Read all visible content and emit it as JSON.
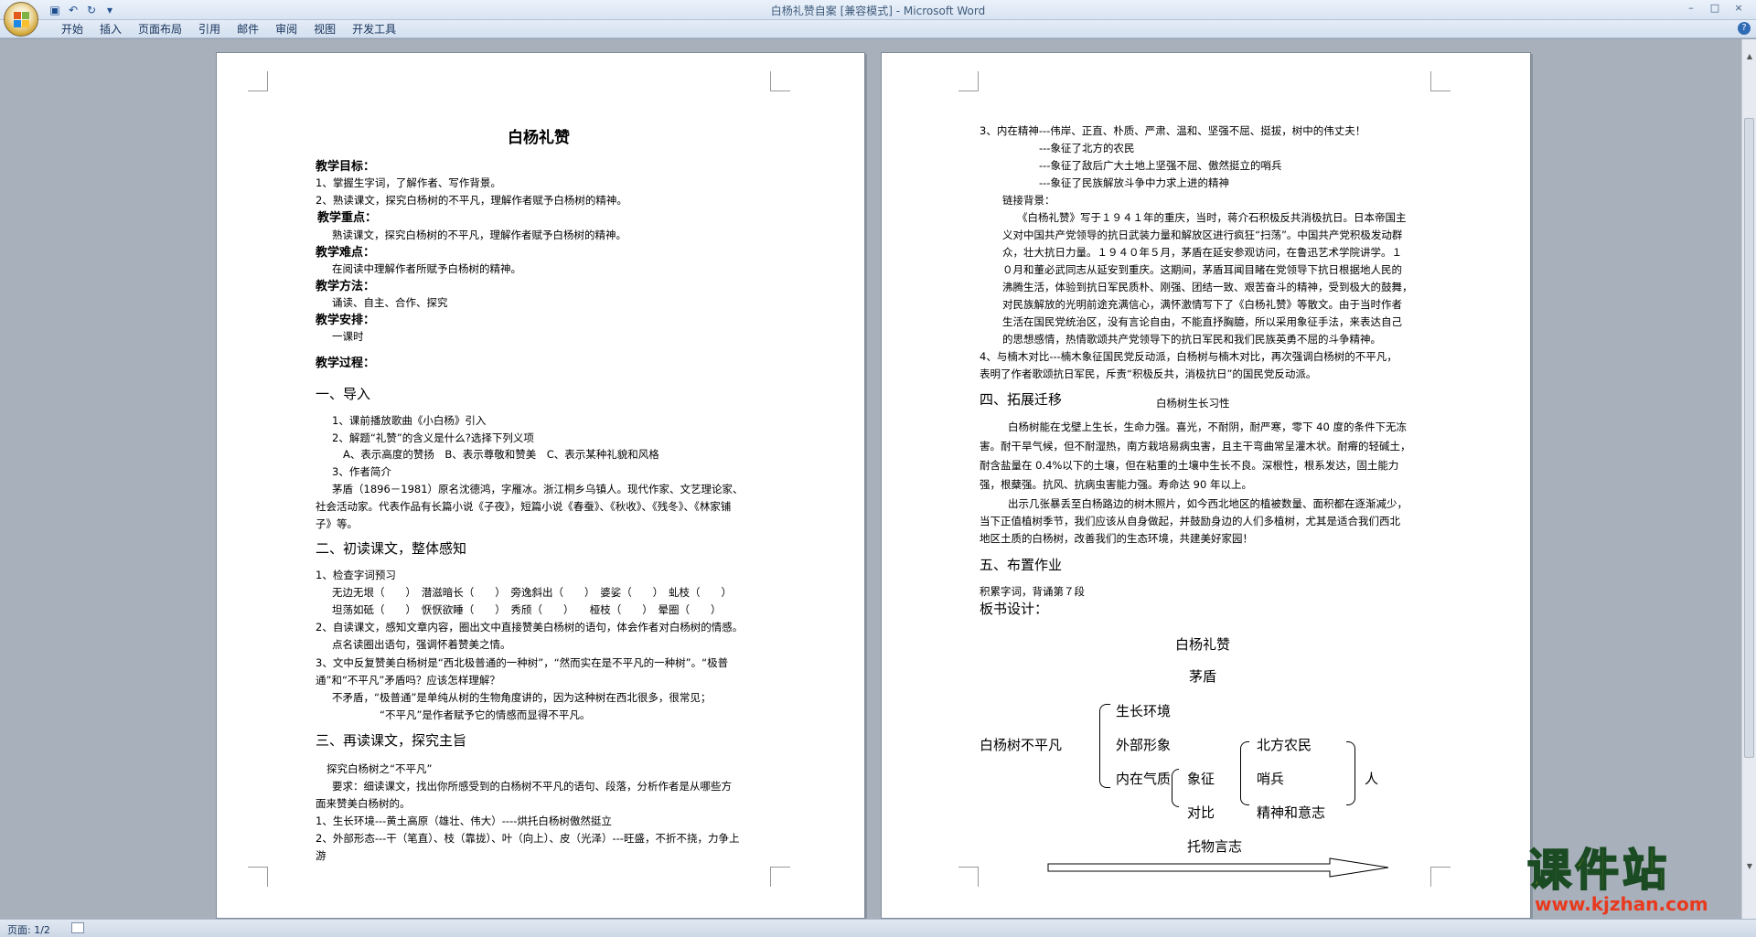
{
  "window": {
    "title": "白杨礼赞自案 [兼容模式] - Microsoft Word",
    "controls": [
      "–",
      "□",
      "×"
    ]
  },
  "ribbon": {
    "tabs": [
      "开始",
      "插入",
      "页面布局",
      "引用",
      "邮件",
      "审阅",
      "视图",
      "开发工具"
    ],
    "help": "?"
  },
  "status": {
    "page": "页面: 1/2"
  },
  "page1": {
    "title": "白杨礼赞",
    "goal_h": "教学目标：",
    "goal_1": "1、掌握生字词，了解作者、写作背景。",
    "goal_2": "2、熟读课文，探究白杨树的不平凡，理解作者赋予白杨树的精神。",
    "key_h": "教学重点：",
    "key_1": "熟读课文，探究白杨树的不平凡，理解作者赋予白杨树的精神。",
    "diff_h": "教学难点：",
    "diff_1": "在阅读中理解作者所赋予白杨树的精神。",
    "method_h": "教学方法：",
    "method_1": "诵读、自主、合作、探究",
    "arr_h": "教学安排：",
    "arr_1": "一课时",
    "proc_h": "教学过程：",
    "s1": "一、导入",
    "s1_1": "1、课前播放歌曲《小白杨》引入",
    "s1_2": "2、解题“礼赞”的含义是什么?选择下列义项",
    "s1_3": "A、表示高度的赞扬　B、表示尊敬和赞美　C、表示某种礼貌和风格",
    "s1_4": "3、作者简介",
    "s1_5": "茅盾（1896－1981）原名沈德鸿，字雁冰。浙江桐乡乌镇人。现代作家、文艺理论家、",
    "s1_6": "社会活动家。代表作品有长篇小说《子夜》，短篇小说《春蚕》、《秋收》、《残冬》、《林家铺",
    "s1_7": "子》等。",
    "s2": "二、初读课文，整体感知",
    "s2_1": "1、检查字词预习",
    "s2_2": "无边无垠（　　）　潜滋暗长（　　）　旁逸斜出（　　）　婆娑（　　）　虬枝（　　）",
    "s2_3": "坦荡如砥（　　）　恹恹欲睡（　　）　秀颀（　　）　　桠枝（　　）　晕圈（　　）",
    "s2_4": "2、自读课文，感知文章内容，圈出文中直接赞美白杨树的语句，体会作者对白杨树的情感。",
    "s2_5": "点名读圈出语句，强调怀着赞美之情。",
    "s2_6": "3、文中反复赞美白杨树是“西北极普通的一种树”，“然而实在是不平凡的一种树”。“极普",
    "s2_7": "通”和“不平凡”矛盾吗？应该怎样理解？",
    "s2_8": "不矛盾，“极普通”是单纯从树的生物角度讲的，因为这种树在西北很多，很常见；",
    "s2_9": "“不平凡”是作者赋予它的情感而显得不平凡。",
    "s3": "三、再读课文，探究主旨",
    "s3_1": "探究白杨树之“不平凡”",
    "s3_2": "要求：细读课文，找出你所感受到的白杨树不平凡的语句、段落，分析作者是从哪些方",
    "s3_3": "面来赞美白杨树的。",
    "s3_4": "1、生长环境---黄土高原（雄壮、伟大）----烘托白杨树傲然挺立",
    "s3_5": "2、外部形态---干（笔直）、枝（靠拢）、叶（向上）、皮（光泽）---旺盛，不折不挠，力争上",
    "s3_6": "游"
  },
  "page2": {
    "a1": "3、内在精神---伟岸、正直、朴质、严肃、温和、坚强不屈、挺拔，树中的伟丈夫！",
    "a2": "---象征了北方的农民",
    "a3": "---象征了敌后广大土地上坚强不屈、傲然挺立的哨兵",
    "a4": "---象征了民族解放斗争中力求上进的精神",
    "a5": "链接背景：",
    "a6": "《白杨礼赞》写于１９４１年的重庆，当时，蒋介石积极反共消极抗日。日本帝国主",
    "a7": "义对中国共产党领导的抗日武装力量和解放区进行疯狂“扫荡”。中国共产党积极发动群",
    "a8": "众，壮大抗日力量。１９４０年５月，茅盾在延安参观访问，在鲁迅艺术学院讲学。１",
    "a9": "０月和董必武同志从延安到重庆。这期间，茅盾耳闻目睹在党领导下抗日根据地人民的",
    "a10": "沸腾生活，体验到抗日军民质朴、刚强、团结一致、艰苦奋斗的精神，受到极大的鼓舞，",
    "a11": "对民族解放的光明前途充满信心，满怀激情写下了《白杨礼赞》等散文。由于当时作者",
    "a12": "生活在国民党统治区，没有言论自由，不能直抒胸臆，所以采用象征手法，来表达自己",
    "a13": "的思想感情，热情歌颂共产党领导下的抗日军民和我们民族英勇不屈的斗争精神。",
    "a14": "4、与楠木对比---楠木象征国民党反动派，白杨树与楠木对比，再次强调白杨树的不平凡，",
    "a15": "表明了作者歌颂抗日军民，斥责“积极反共，消极抗日”的国民党反动派。",
    "s4": "四、拓展迁移",
    "s4_sub": "白杨树生长习性",
    "s4_1": "白杨树能在戈壁上生长，生命力强。喜光，不耐阴，耐严寒，零下 40 度的条件下无冻",
    "s4_2": "害。耐干旱气候，但不耐湿热，南方栽培易病虫害，且主干弯曲常呈灌木状。耐瘠的轻碱土，",
    "s4_3": "耐含盐量在 0.4%以下的土壤，但在粘重的土壤中生长不良。深根性，根系发达，固土能力",
    "s4_4": "强，根蘖强。抗风、抗病虫害能力强。寿命达 90 年以上。",
    "s4_5": "出示几张暴丢至白杨路边的树木照片，如今西北地区的植被数量、面积都在逐渐减少，",
    "s4_6": "当下正值植树季节，我们应该从自身做起，并鼓励身边的人们多植树，尤其是适合我们西北",
    "s4_7": "地区土质的白杨树，改善我们的生态环境，共建美好家园！",
    "s5": "五、布置作业",
    "s5_1": "积累字词，背诵第７段",
    "s6": "板书设计：",
    "bd_title": "白杨礼赞",
    "bd_author": "茅盾",
    "bd_main": "白杨树不平凡",
    "bd_env": "生长环境",
    "bd_form": "外部形象",
    "bd_inner": "内在气质",
    "bd_sym": "象征",
    "bd_cmp": "对比",
    "bd_farmer": "北方农民",
    "bd_sentry": "哨兵",
    "bd_spirit": "精神和意志",
    "bd_people": "人",
    "bd_tuo": "托物言志"
  },
  "watermark": {
    "cn": "课件站",
    "url": "www.kjzhan.com"
  }
}
